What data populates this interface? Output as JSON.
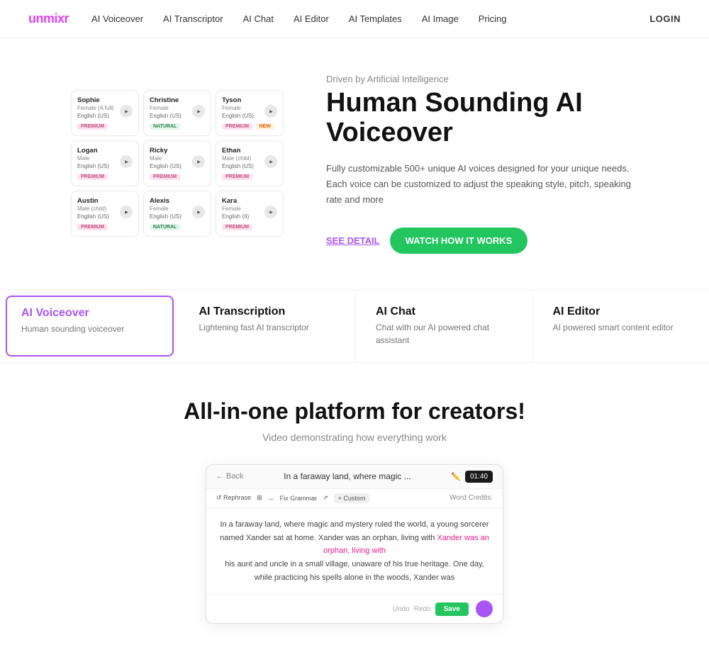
{
  "brand": {
    "name_start": "un",
    "name_accent": "mix",
    "name_end": "r"
  },
  "nav": {
    "links": [
      {
        "label": "AI Voiceover",
        "id": "ai-voiceover"
      },
      {
        "label": "AI Transcriptor",
        "id": "ai-transcriptor"
      },
      {
        "label": "AI Chat",
        "id": "ai-chat"
      },
      {
        "label": "AI Editor",
        "id": "ai-editor"
      },
      {
        "label": "AI Templates",
        "id": "ai-templates"
      },
      {
        "label": "AI Image",
        "id": "ai-image"
      },
      {
        "label": "Pricing",
        "id": "pricing"
      }
    ],
    "login": "LOGIN"
  },
  "hero": {
    "driven": "Driven by Artificial Intelligence",
    "title": "Human Sounding AI Voiceover",
    "description": "Fully customizable 500+ unique AI voices designed for your unique needs. Each voice can be customized to adjust the speaking style, pitch, speaking rate and more",
    "btn_see": "SEE DETAIL",
    "btn_watch": "WATCH HOW IT WORKS"
  },
  "voices": [
    {
      "name": "Sophie",
      "gender": "Female (A full)",
      "lang": "English (US)",
      "tag": "premium",
      "tag_label": "PREMIUM"
    },
    {
      "name": "Christine",
      "gender": "Female",
      "lang": "English (US)",
      "tag": "natural",
      "tag_label": "NATURAL"
    },
    {
      "name": "Tyson",
      "gender": "Female",
      "lang": "English (US)",
      "tag": "new",
      "tag_label": "PREMIUM"
    },
    {
      "name": "Logan",
      "gender": "Male",
      "lang": "English (US)",
      "tag": "premium",
      "tag_label": "PREMIUM"
    },
    {
      "name": "Ricky",
      "gender": "Male",
      "lang": "English (US)",
      "tag": "premium",
      "tag_label": "PREMIUM"
    },
    {
      "name": "Ethan",
      "gender": "Male (child)",
      "lang": "English (US)",
      "tag": "premium",
      "tag_label": "PREMIUM"
    },
    {
      "name": "Austin",
      "gender": "Male (child)",
      "lang": "English (US)",
      "tag": "premium",
      "tag_label": "PREMIUM"
    },
    {
      "name": "Alexis",
      "gender": "Female",
      "lang": "English (US)",
      "tag": "natural",
      "tag_label": "NATURAL"
    },
    {
      "name": "Kara",
      "gender": "Female",
      "lang": "English (It)",
      "tag": "premium",
      "tag_label": "PREMIUM"
    }
  ],
  "features": [
    {
      "id": "ai-voiceover",
      "title": "AI Voiceover",
      "desc": "Human sounding voiceover",
      "active": true
    },
    {
      "id": "ai-transcription",
      "title": "AI Transcription",
      "desc": "Lightening fast AI transcriptor",
      "active": false
    },
    {
      "id": "ai-chat",
      "title": "AI Chat",
      "desc": "Chat with our AI powered chat assistant",
      "active": false
    },
    {
      "id": "ai-editor",
      "title": "AI Editor",
      "desc": "AI powered smart content editor",
      "active": false
    }
  ],
  "allinone": {
    "title": "All-in-one platform for creators!",
    "subtitle": "Video demonstrating how everything work"
  },
  "demo": {
    "back": "← Back",
    "title": "In a faraway land, where magic ...",
    "timer": "01:40",
    "toolbar_left": [
      "↺ Rephrase",
      "⊞",
      "↔",
      "Fix Grammar",
      "↗",
      "+ Custom"
    ],
    "credits_label": "Word Credits:",
    "undo": "Undo",
    "redo": "Redo",
    "save": "Save",
    "content_line1": "In a faraway land, where magic and mystery ruled the world, a young sorcerer named Xander sat at home. Xander was an orphan, living with",
    "content_line2": "his aunt and uncle in a small village, unaware of his true heritage. One day, while practicing his spells alone in the woods, Xander was"
  }
}
